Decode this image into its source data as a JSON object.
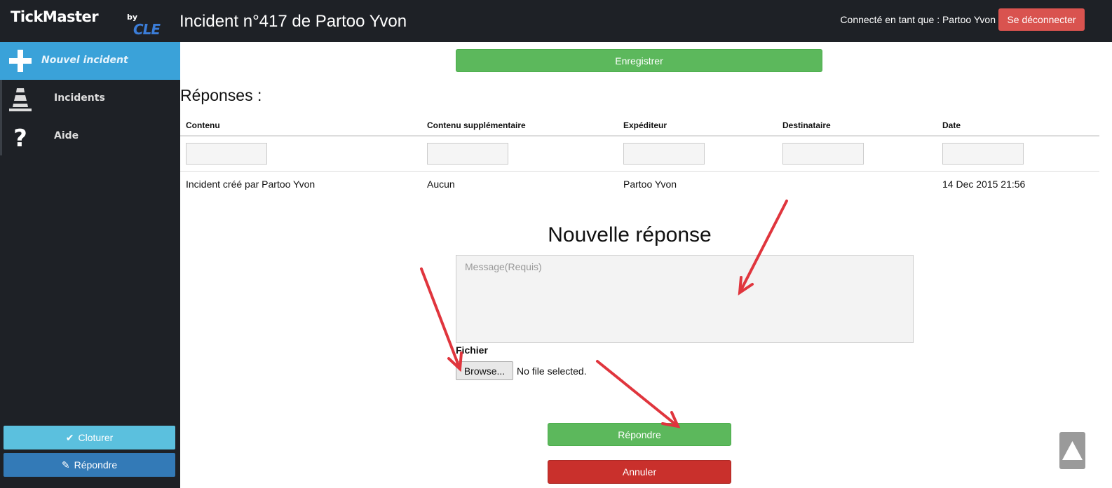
{
  "header": {
    "logo_text": "TickMaster",
    "logo_by": "by",
    "logo_brand": "CLE",
    "title": "Incident n°417 de Partoo Yvon",
    "user_label": "Connecté en tant que : Partoo Yvon",
    "logout_label": "Se déconnecter"
  },
  "sidebar": {
    "items": [
      {
        "label": "Nouvel incident",
        "icon": "plus-icon"
      },
      {
        "label": "Incidents",
        "icon": "traffic-cone-icon"
      },
      {
        "label": "Aide",
        "icon": "question-icon"
      }
    ],
    "close_label": "Cloturer",
    "reply_label": "Répondre"
  },
  "main": {
    "save_label": "Enregistrer",
    "responses_title": "Réponses :",
    "table": {
      "columns": [
        "Contenu",
        "Contenu supplémentaire",
        "Expéditeur",
        "Destinataire",
        "Date"
      ],
      "rows": [
        [
          "Incident créé par Partoo Yvon",
          "Aucun",
          "Partoo Yvon",
          "",
          "14 Dec 2015 21:56"
        ]
      ]
    },
    "new_reply_title": "Nouvelle réponse",
    "message_placeholder": "Message(Requis)",
    "file_label": "Fichier",
    "browse_label": "Browse...",
    "file_status": "No file selected.",
    "reply_label": "Répondre",
    "cancel_label": "Annuler"
  },
  "colors": {
    "header_bg": "#1e2126",
    "accent_blue": "#3aa2d9",
    "success_green": "#5cb85c",
    "danger_red": "#d9534f",
    "cancel_red": "#c9302c",
    "info_cyan": "#5bc0de",
    "primary_blue": "#337ab7",
    "annotation_arrow": "#e0353d"
  }
}
